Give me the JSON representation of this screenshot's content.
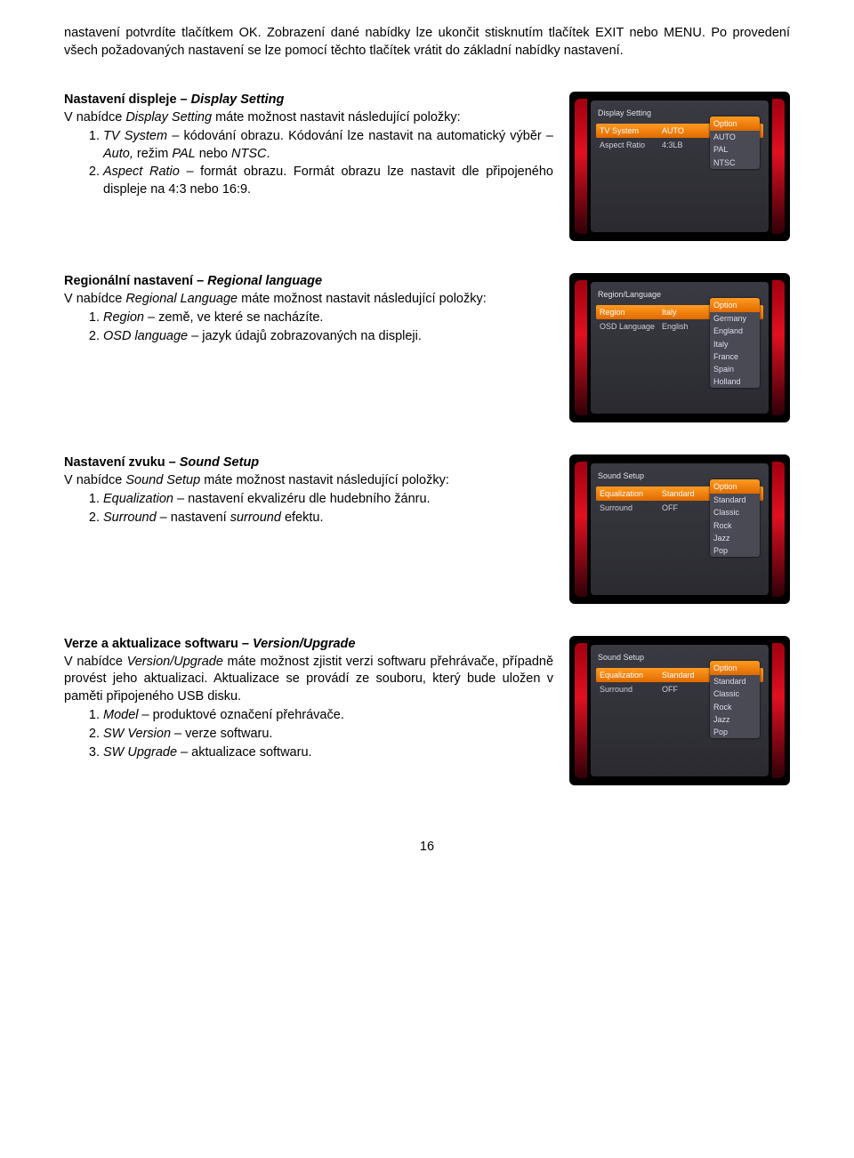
{
  "intro": "nastavení potvrdíte tlačítkem OK. Zobrazení dané nabídky lze ukončit stisknutím tlačítek EXIT nebo MENU. Po provedení všech požadovaných nastavení se lze pomocí těchto tlačítek vrátit do základní nabídky nastavení.",
  "sections": [
    {
      "title_plain": "Nastavení displeje – ",
      "title_italic": "Display Setting",
      "lead_pre": "V nabídce ",
      "lead_italic": "Display Setting",
      "lead_post": " máte možnost nastavit následující položky:",
      "items": [
        {
          "em": "TV System",
          "rest": " – kódování obrazu. Kódování lze nastavit na automatický výběr – ",
          "em2": "Auto,",
          "rest2": " režim ",
          "em3": "PAL",
          "rest3": " nebo ",
          "em4": "NTSC",
          "rest4": "."
        },
        {
          "em": "Aspect Ratio",
          "rest": " – formát obrazu. Formát obrazu lze nastavit dle připojeného displeje na 4:3 nebo 16:9."
        }
      ],
      "shot": {
        "title": "Display Setting",
        "rows": [
          {
            "label": "TV System",
            "value": "AUTO",
            "selected": true
          },
          {
            "label": "Aspect Ratio",
            "value": "4:3LB",
            "selected": false
          }
        ],
        "options_head": "Option",
        "options": [
          "AUTO",
          "PAL",
          "NTSC"
        ]
      }
    },
    {
      "title_plain": "Regionální nastavení – ",
      "title_italic": "Regional language",
      "lead_pre": "V nabídce ",
      "lead_italic": "Regional Language",
      "lead_post": " máte možnost nastavit následující položky:",
      "items": [
        {
          "em": "Region",
          "rest": " – země, ve které se nacházíte."
        },
        {
          "em": "OSD language",
          "rest": " – jazyk údajů zobrazovaných na displeji."
        }
      ],
      "shot": {
        "title": "Region/Language",
        "rows": [
          {
            "label": "Region",
            "value": "Italy",
            "selected": true
          },
          {
            "label": "OSD Language",
            "value": "English",
            "selected": false
          }
        ],
        "options_head": "Option",
        "options": [
          "Germany",
          "England",
          "Italy",
          "France",
          "Spain",
          "Holland"
        ]
      }
    },
    {
      "title_plain": "Nastavení zvuku – ",
      "title_italic": "Sound Setup",
      "lead_pre": "V nabídce ",
      "lead_italic": "Sound Setup",
      "lead_post": " máte možnost nastavit následující položky:",
      "items": [
        {
          "em": "Equalization",
          "rest": " – nastavení ekvalizéru dle hudebního žánru."
        },
        {
          "em": "Surround",
          "rest": " – nastavení ",
          "em2": "surround",
          "rest2": " efektu."
        }
      ],
      "shot": {
        "title": "Sound Setup",
        "rows": [
          {
            "label": "Equalization",
            "value": "Standard",
            "selected": true
          },
          {
            "label": "Surround",
            "value": "OFF",
            "selected": false
          }
        ],
        "options_head": "Option",
        "options": [
          "Standard",
          "Classic",
          "Rock",
          "Jazz",
          "Pop"
        ]
      }
    },
    {
      "title_plain": "Verze a aktualizace softwaru – ",
      "title_italic": "Version/Upgrade",
      "lead_pre": "V nabídce ",
      "lead_italic": "Version/Upgrade",
      "lead_post": " máte možnost zjistit verzi softwaru přehrávače, případně provést jeho aktualizaci. Aktualizace se provádí ze souboru, který bude uložen v paměti připojeného USB disku.",
      "items": [
        {
          "em": "Model",
          "rest": " – produktové označení přehrávače."
        },
        {
          "em": "SW Version",
          "rest": " – verze softwaru."
        },
        {
          "em": "SW Upgrade",
          "rest": " – aktualizace softwaru."
        }
      ],
      "shot": {
        "title": "Sound Setup",
        "rows": [
          {
            "label": "Equalization",
            "value": "Standard",
            "selected": true
          },
          {
            "label": "Surround",
            "value": "OFF",
            "selected": false
          }
        ],
        "options_head": "Option",
        "options": [
          "Standard",
          "Classic",
          "Rock",
          "Jazz",
          "Pop"
        ]
      }
    }
  ],
  "page_number": "16"
}
